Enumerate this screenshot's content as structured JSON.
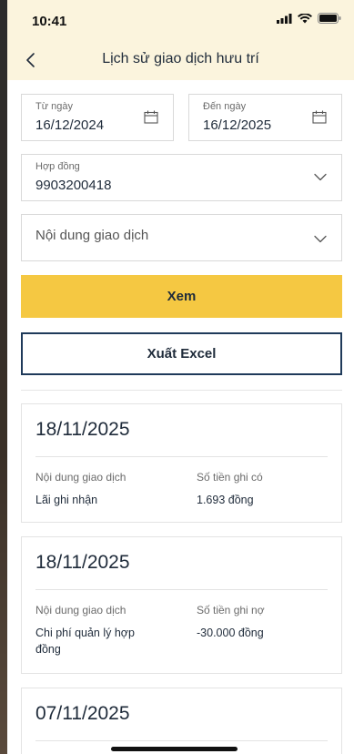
{
  "status": {
    "time": "10:41"
  },
  "header": {
    "title": "Lịch sử giao dịch hưu trí"
  },
  "filters": {
    "from_date": {
      "label": "Từ ngày",
      "value": "16/12/2024"
    },
    "to_date": {
      "label": "Đến ngày",
      "value": "16/12/2025"
    },
    "contract": {
      "label": "Hợp đồng",
      "value": "9903200418"
    },
    "transaction_type": {
      "placeholder": "Nội dung giao dịch"
    }
  },
  "actions": {
    "view_label": "Xem",
    "export_label": "Xuất Excel"
  },
  "transactions": [
    {
      "date": "18/11/2025",
      "desc_label": "Nội dung giao dịch",
      "desc": "Lãi ghi nhận",
      "amount_label": "Số tiền ghi có",
      "amount": "1.693 đồng"
    },
    {
      "date": "18/11/2025",
      "desc_label": "Nội dung giao dịch",
      "desc": "Chi phí quản lý hợp đồng",
      "amount_label": "Số tiền ghi nợ",
      "amount": "-30.000 đồng"
    },
    {
      "date": "07/11/2025"
    }
  ]
}
